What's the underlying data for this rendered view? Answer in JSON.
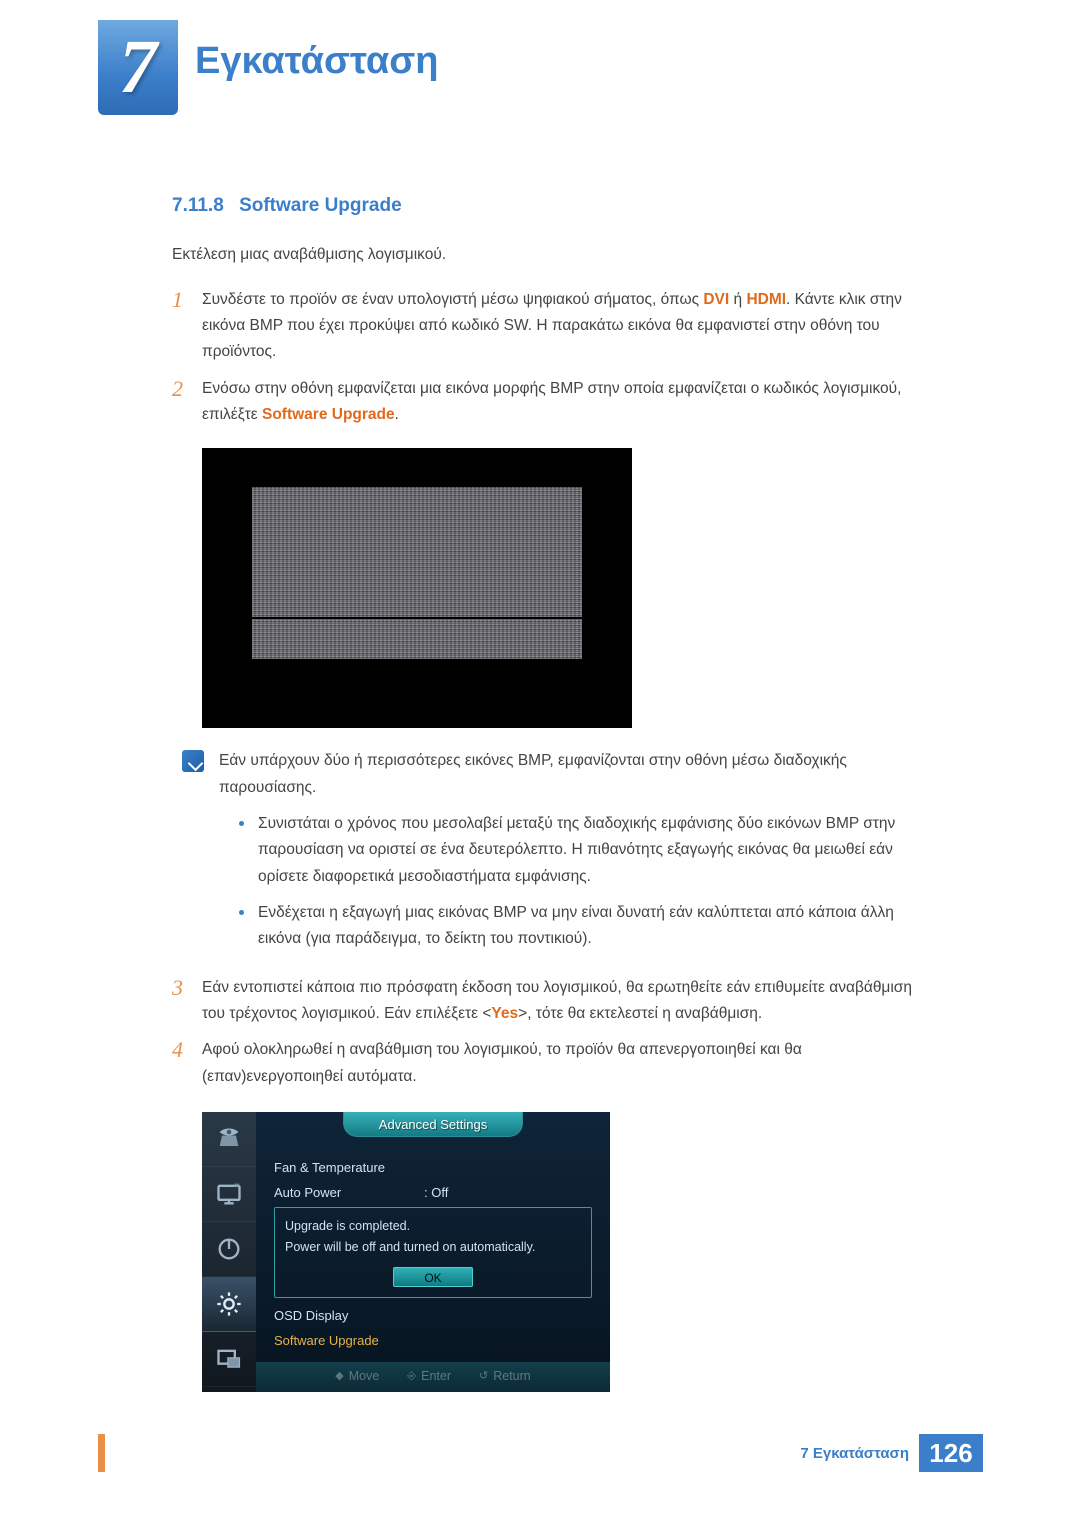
{
  "chapter": {
    "num": "7",
    "title": "Εγκατάσταση"
  },
  "section": {
    "num": "7.11.8",
    "title": "Software Upgrade"
  },
  "intro": "Εκτέλεση μιας αναβάθμισης λογισμικού.",
  "steps": {
    "s1": {
      "n": "1",
      "t1": "Συνδέστε το προϊόν σε έναν υπολογιστή μέσω ψηφιακού σήματος, όπως ",
      "dvi": "DVI",
      "or": " ή ",
      "hdmi": "HDMI",
      "t2": ". Κάντε κλικ στην εικόνα BMP που έχει προκύψει από κωδικό SW. Η παρακάτω εικόνα θα εμφανιστεί στην οθόνη του προϊόντος."
    },
    "s2": {
      "n": "2",
      "t1": "Ενόσω στην οθόνη εμφανίζεται μια εικόνα μορφής BMP στην οποία εμφανίζεται ο κωδικός λογισμικού, επιλέξτε ",
      "su": "Software Upgrade",
      "t2": "."
    },
    "s3": {
      "n": "3",
      "t1": "Εάν εντοπιστεί κάποια πιο πρόσφατη έκδοση του λογισμικού, θα ερωτηθείτε εάν επιθυμείτε αναβάθμιση του τρέχοντος λογισμικού. Εάν επιλέξετε <",
      "yes": "Yes",
      "t2": ">, τότε θα εκτελεστεί η αναβάθμιση."
    },
    "s4": {
      "n": "4",
      "t": "Αφού ολοκληρωθεί η αναβάθμιση του λογισμικού, το προϊόν θα απενεργοποιηθεί και θα (επαν)ενεργοποιηθεί αυτόματα."
    }
  },
  "note": {
    "main": "Εάν υπάρχουν δύο ή περισσότερες εικόνες BMP, εμφανίζονται στην οθόνη μέσω διαδοχικής παρουσίασης.",
    "b1": "Συνιστάται ο χρόνος που μεσολαβεί μεταξύ της διαδοχικής εμφάνισης δύο εικόνων BMP στην παρουσίαση να οριστεί σε ένα δευτερόλεπτο. Η πιθανότητς εξαγωγής εικόνας θα μειωθεί εάν ορίσετε διαφορετικά μεσοδιαστήματα εμφάνισης.",
    "b2": "Ενδέχεται η εξαγωγή μιας εικόνας BMP να μην είναι δυνατή εάν καλύπτεται από κάποια άλλη εικόνα (για παράδειγμα, το δείκτη του ποντικιού)."
  },
  "osd": {
    "title": "Advanced Settings",
    "fan": "Fan & Temperature",
    "auto": "Auto Power",
    "auto_val": ": Off",
    "dlg1": "Upgrade is completed.",
    "dlg2": "Power will be off and turned on automatically.",
    "ok": "OK",
    "osddisp": "OSD Display",
    "swup": "Software Upgrade",
    "foot": {
      "move": "Move",
      "enter": "Enter",
      "return": "Return"
    }
  },
  "icons": {
    "picture": "picture-icon",
    "screen": "screen-icon",
    "power": "power-icon",
    "gear": "gear-icon",
    "pip": "pip-icon"
  },
  "footer": {
    "label": "7 Εγκατάσταση",
    "page": "126"
  }
}
